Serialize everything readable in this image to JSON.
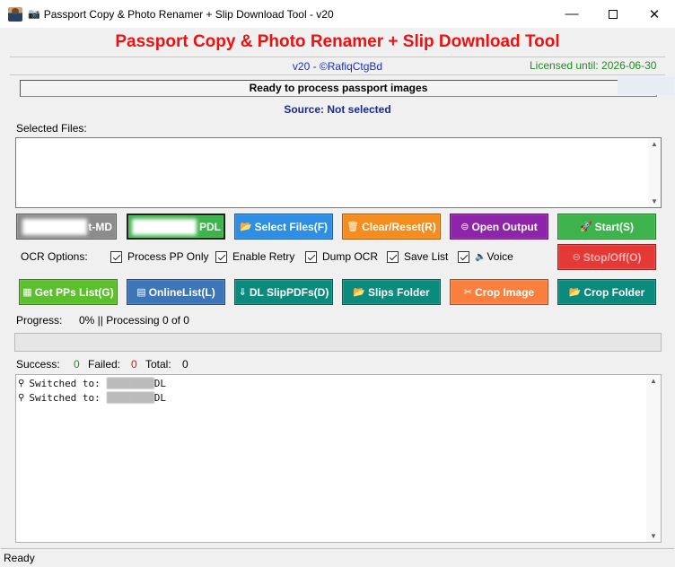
{
  "window": {
    "title": "Passport Copy & Photo Renamer + Slip Download Tool - v20",
    "minimize_glyph": "—",
    "close_glyph": "✕"
  },
  "header": {
    "title": "Passport Copy & Photo Renamer + Slip Download Tool",
    "version": "v20 - ©RafiqCtgBd",
    "license": "Licensed until: 2026-06-30",
    "ready": "Ready to process passport images",
    "source": "Source: Not selected"
  },
  "files": {
    "label": "Selected Files:"
  },
  "buttons": {
    "row1": {
      "first": "t-MD",
      "second": "PDL",
      "select_files": "Select Files(F)",
      "clear_reset": "Clear/Reset(R)",
      "open_output": "Open Output",
      "start": "Start(S)"
    },
    "stop": "Stop/Off(O)",
    "row2": {
      "get_pps_list": "Get PPs List(G)",
      "online_list": "OnlineList(L)",
      "dl_slip_pdfs": "DL SlipPDFs(D)",
      "slips_folder": "Slips Folder",
      "crop_image": "Crop Image",
      "crop_folder": "Crop Folder"
    }
  },
  "ocr": {
    "label": "OCR Options:",
    "options": [
      "Process PP Only",
      "Enable Retry",
      "Dump OCR",
      "Save List",
      "Voice"
    ]
  },
  "progress": {
    "label": "Progress:",
    "text": "0% || Processing 0 of 0",
    "percent": 0
  },
  "stats": {
    "success_label": "Success:",
    "success": "0",
    "failed_label": "Failed:",
    "failed": "0",
    "total_label": "Total:",
    "total": "0"
  },
  "log": {
    "lines": [
      {
        "prefix": "Switched to:",
        "suffix": "DL"
      },
      {
        "prefix": "Switched to:",
        "suffix": "DL"
      }
    ]
  },
  "status": "Ready",
  "colors": {
    "title_red": "#ee1111",
    "version_blue": "#1b2fc8",
    "license_green": "#1f8c1f",
    "source_navy": "#1a2b8c",
    "btn_grey": "#8c8c8c",
    "btn_green": "#3cb44b",
    "btn_blue": "#2e8de4",
    "btn_orange": "#f58c1e",
    "btn_purple": "#8e24aa",
    "btn_red": "#e53935",
    "btn_lime": "#5cc02c",
    "btn_steel": "#3d76b8",
    "btn_teal": "#0b8a7e",
    "btn_coral": "#f97f3e",
    "success_green": "#1f8c1f",
    "failed_red": "#dd1111"
  }
}
